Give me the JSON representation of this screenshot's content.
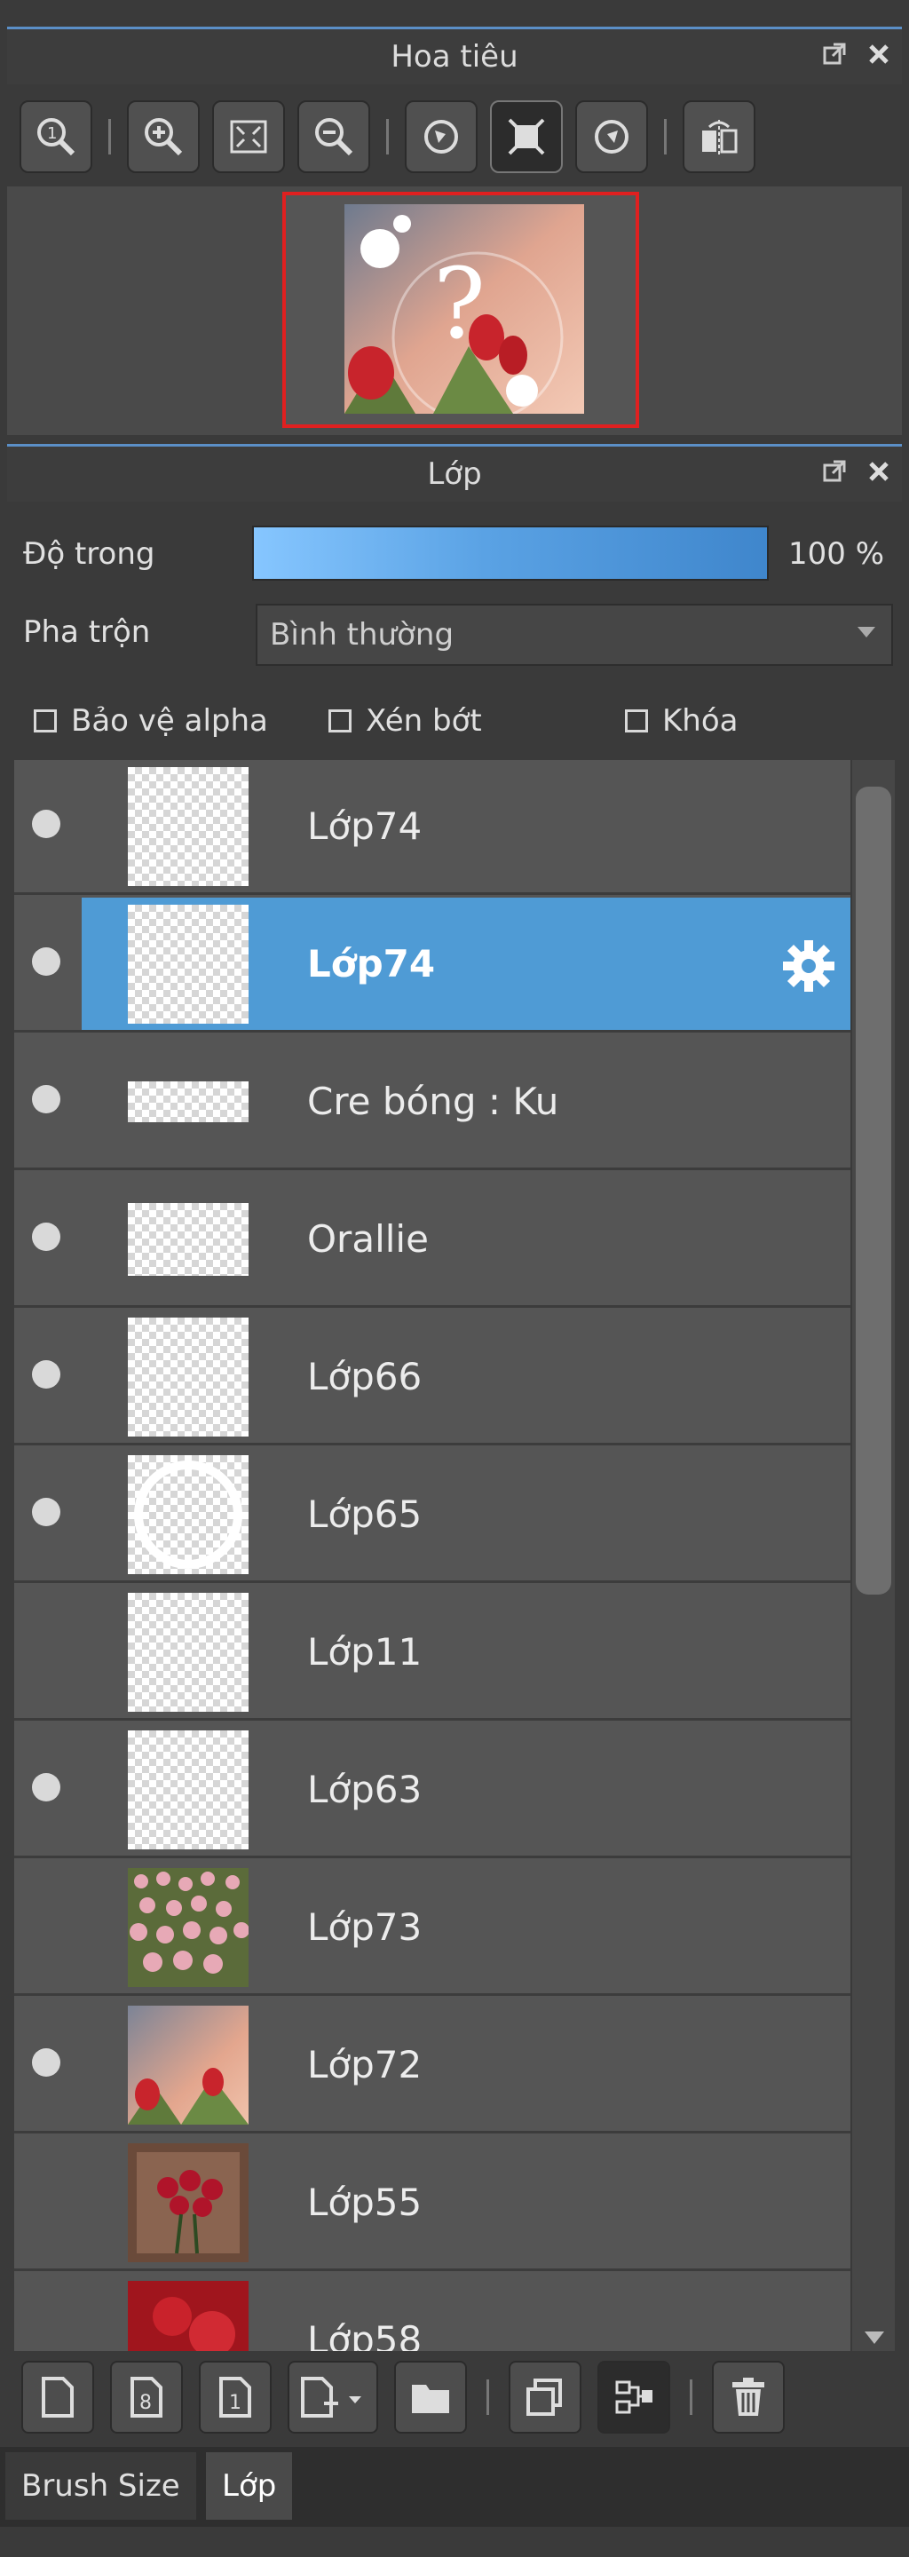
{
  "navigator": {
    "title": "Hoa tiêu",
    "tools": [
      {
        "icon": "zoom-actual-icon"
      },
      {
        "icon": "zoom-in-icon"
      },
      {
        "icon": "fit-screen-icon"
      },
      {
        "icon": "zoom-out-icon"
      },
      {
        "icon": "rotate-left-icon"
      },
      {
        "icon": "reset-view-icon"
      },
      {
        "icon": "rotate-right-icon"
      },
      {
        "icon": "flip-horizontal-icon"
      }
    ]
  },
  "layers_panel": {
    "title": "Lớp",
    "opacity_label": "Độ trong",
    "opacity_value": "100 %",
    "blend_label": "Pha trộn",
    "blend_value": "Bình thường",
    "checkboxes": {
      "protect_alpha": "Bảo vệ alpha",
      "clipping": "Xén bớt",
      "lock": "Khóa"
    },
    "layers": [
      {
        "name": "Lớp74",
        "visible": true,
        "selected": false
      },
      {
        "name": "Lớp74",
        "visible": true,
        "selected": true
      },
      {
        "name": "Cre bóng : Ku",
        "visible": true,
        "selected": false
      },
      {
        "name": "Orallie",
        "visible": true,
        "selected": false
      },
      {
        "name": "Lớp66",
        "visible": true,
        "selected": false
      },
      {
        "name": "Lớp65",
        "visible": true,
        "selected": false
      },
      {
        "name": "Lớp11",
        "visible": false,
        "selected": false
      },
      {
        "name": "Lớp63",
        "visible": true,
        "selected": false
      },
      {
        "name": "Lớp73",
        "visible": false,
        "selected": false
      },
      {
        "name": "Lớp72",
        "visible": true,
        "selected": false
      },
      {
        "name": "Lớp55",
        "visible": false,
        "selected": false
      },
      {
        "name": "Lớp58",
        "visible": false,
        "selected": false
      }
    ]
  },
  "bottom_tabs": [
    "Brush Size",
    "Lớp"
  ],
  "colors": {
    "accent": "#4f9bd5",
    "nav_frame": "#e02020"
  }
}
